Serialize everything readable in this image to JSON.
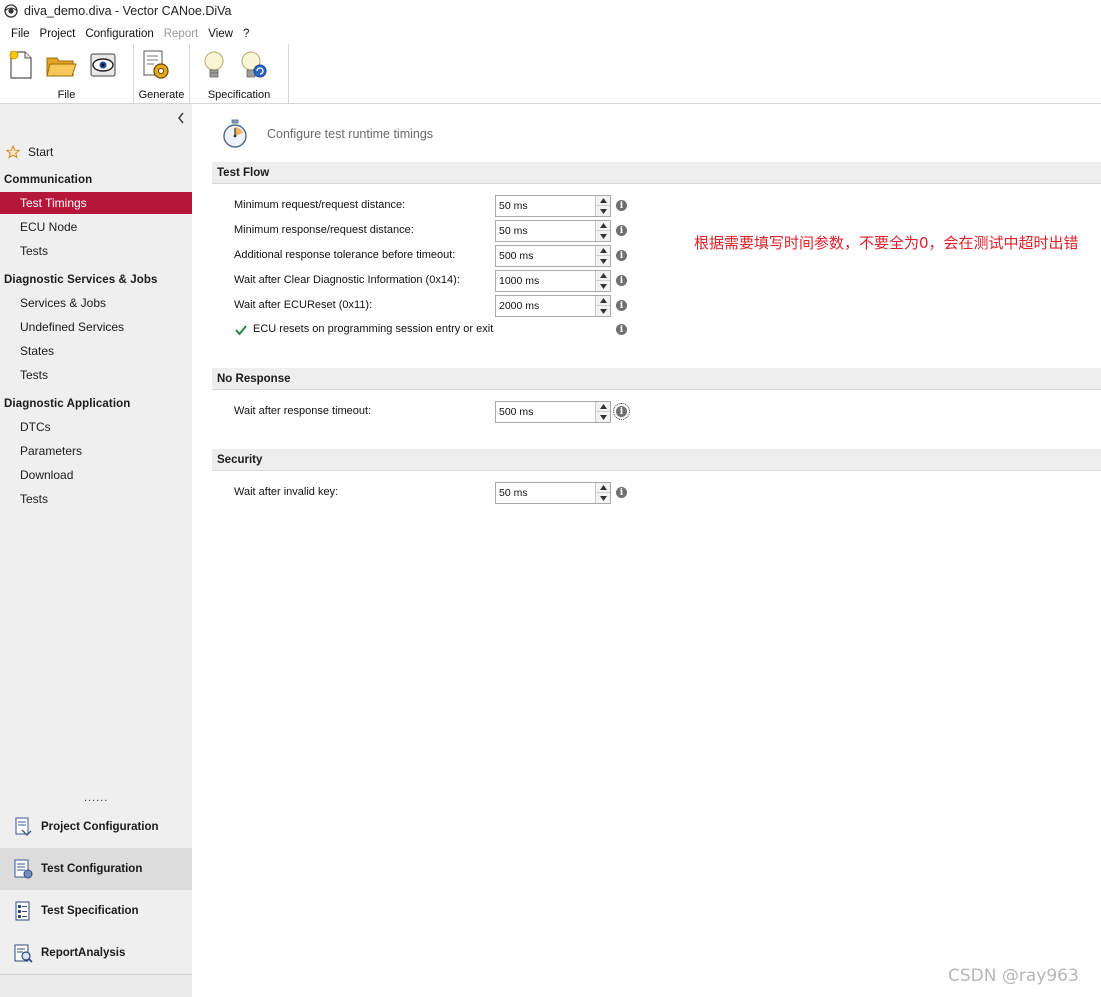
{
  "window": {
    "title": "diva_demo.diva - Vector CANoe.DiVa"
  },
  "menu": [
    "File",
    "Project",
    "Configuration",
    "Report",
    "View",
    "?"
  ],
  "menu_disabled": [
    "Report"
  ],
  "ribbon": {
    "groups": [
      {
        "label": "File",
        "buttons": [
          "new-file-icon",
          "open-folder-icon",
          "camera-icon"
        ]
      },
      {
        "label": "Generate",
        "buttons": [
          "generate-gear-icon"
        ]
      },
      {
        "label": "Specification",
        "buttons": [
          "light-bulb-icon",
          "light-bulb-refresh-icon"
        ]
      }
    ]
  },
  "sidebar": {
    "start": "Start",
    "communication": {
      "title": "Communication",
      "items": [
        "Test Timings",
        "ECU Node",
        "Tests"
      ]
    },
    "services": {
      "title": "Diagnostic Services & Jobs",
      "items": [
        "Services & Jobs",
        "Undefined Services",
        "States",
        "Tests"
      ]
    },
    "application": {
      "title": "Diagnostic Application",
      "items": [
        "DTCs",
        "Parameters",
        "Download",
        "Tests"
      ]
    },
    "active_item": "Test Timings",
    "overflow": "......",
    "bottom": [
      "Project Configuration",
      "Test Configuration",
      "Test Specification",
      "ReportAnalysis"
    ],
    "bottom_selected": "Test Configuration"
  },
  "main": {
    "title": "Configure test runtime timings",
    "test_flow": {
      "title": "Test Flow",
      "fields": [
        {
          "label": "Minimum request/request distance:",
          "value": "50 ms"
        },
        {
          "label": "Minimum response/request distance:",
          "value": "50 ms"
        },
        {
          "label": "Additional response tolerance before timeout:",
          "value": "500 ms"
        },
        {
          "label": "Wait after Clear Diagnostic Information (0x14):",
          "value": "1000 ms"
        },
        {
          "label": "Wait after ECUReset (0x11):",
          "value": "2000 ms"
        }
      ],
      "checkbox": {
        "label": "ECU resets on programming session entry or exit",
        "checked": true
      }
    },
    "no_response": {
      "title": "No Response",
      "fields": [
        {
          "label": "Wait after response timeout:",
          "value": "500 ms"
        }
      ]
    },
    "security": {
      "title": "Security",
      "fields": [
        {
          "label": "Wait after invalid key:",
          "value": "50 ms"
        }
      ]
    }
  },
  "annotation": "根据需要填写时间参数，不要全为0，会在测试中超时出错",
  "watermark": "CSDN @ray963",
  "colors": {
    "accent": "#b5173a",
    "annotation": "#e0202a",
    "section_bg": "#eeeeee",
    "sidebar_bg": "#efefef"
  }
}
